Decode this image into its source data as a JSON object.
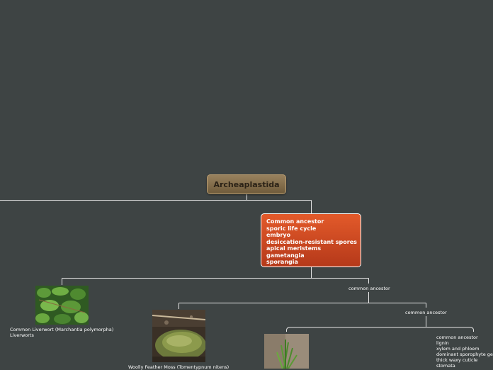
{
  "root": {
    "title": "Archeaplastida"
  },
  "main_node": {
    "lines": [
      "Common ancestor",
      "sporic life cycle",
      "embryo",
      "desiccation-resistant spores",
      "apical meristems",
      "gametangia",
      "sporangia"
    ]
  },
  "branches": {
    "common_ancestor_1": "common ancestor",
    "common_ancestor_2": "common ancestor"
  },
  "liverwort": {
    "line1": "Common Liverwort (Marchantia polymorpha)",
    "line2": "Liverworts"
  },
  "moss": {
    "caption": "Woolly Feather Moss (Tomentypnum nitens)"
  },
  "vascular": {
    "lines": [
      "common ancestor",
      "lignin",
      "xylem and phloem",
      "dominant sporophyte ge",
      "thick waxy cuticle",
      "stomata"
    ]
  },
  "colors": {
    "background": "#3e4444",
    "connector": "#e8e8e8",
    "root_fill": "#8a7350",
    "main_fill": "#d24a22"
  }
}
